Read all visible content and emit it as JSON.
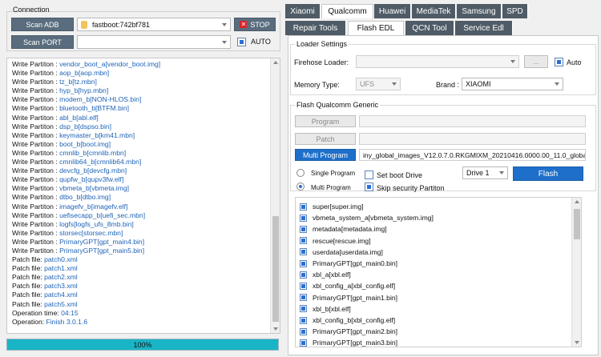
{
  "connection": {
    "title": "Connection",
    "scan_adb_label": "Scan ADB",
    "device_value": "fastboot:742bf781",
    "stop_label": "STOP",
    "scan_port_label": "Scan PORT",
    "port_value": "",
    "auto_label": "AUTO",
    "auto_checked": true
  },
  "log": [
    {
      "label": "Write Partiton : ",
      "value": "vendor_boot_a[vendor_boot.img]"
    },
    {
      "label": "Write Partiton : ",
      "value": "aop_b[aop.mbn]"
    },
    {
      "label": "Write Partiton : ",
      "value": "tz_b[tz.mbn]"
    },
    {
      "label": "Write Partiton : ",
      "value": "hyp_b[hyp.mbn]"
    },
    {
      "label": "Write Partiton : ",
      "value": "modem_b[NON-HLOS.bin]"
    },
    {
      "label": "Write Partiton : ",
      "value": "bluetooth_b[BTFM.bin]"
    },
    {
      "label": "Write Partiton : ",
      "value": "abl_b[abl.elf]"
    },
    {
      "label": "Write Partiton : ",
      "value": "dsp_b[dspso.bin]"
    },
    {
      "label": "Write Partiton : ",
      "value": "keymaster_b[km41.mbn]"
    },
    {
      "label": "Write Partiton : ",
      "value": "boot_b[boot.img]"
    },
    {
      "label": "Write Partiton : ",
      "value": "cmnlib_b[cmnlib.mbn]"
    },
    {
      "label": "Write Partiton : ",
      "value": "cmnlib64_b[cmnlib64.mbn]"
    },
    {
      "label": "Write Partiton : ",
      "value": "devcfg_b[devcfg.mbn]"
    },
    {
      "label": "Write Partiton : ",
      "value": "qupfw_b[qupv3fw.elf]"
    },
    {
      "label": "Write Partiton : ",
      "value": "vbmeta_b[vbmeta.img]"
    },
    {
      "label": "Write Partiton : ",
      "value": "dtbo_b[dtbo.img]"
    },
    {
      "label": "Write Partiton : ",
      "value": "imagefv_b[imagefv.elf]"
    },
    {
      "label": "Write Partiton : ",
      "value": "uefisecapp_b[uefi_sec.mbn]"
    },
    {
      "label": "Write Partiton : ",
      "value": "logfs[logfs_ufs_8mb.bin]"
    },
    {
      "label": "Write Partiton : ",
      "value": "storsec[storsec.mbn]"
    },
    {
      "label": "Write Partiton : ",
      "value": "PrimaryGPT[gpt_main4.bin]"
    },
    {
      "label": "Write Partiton : ",
      "value": "PrimaryGPT[gpt_main5.bin]"
    },
    {
      "label": "Patch file: ",
      "value": "patch0.xml"
    },
    {
      "label": "Patch file: ",
      "value": "patch1.xml"
    },
    {
      "label": "Patch file: ",
      "value": "patch2.xml"
    },
    {
      "label": "Patch file: ",
      "value": "patch3.xml"
    },
    {
      "label": "Patch file: ",
      "value": "patch4.xml"
    },
    {
      "label": "Patch file: ",
      "value": "patch5.xml"
    },
    {
      "label": "Operation time: ",
      "value": "04:15"
    },
    {
      "label": "Operation: ",
      "value": "Finish 3.0.1.6"
    }
  ],
  "progress": {
    "value": 1.0,
    "label": "100%"
  },
  "brand_tabs": [
    {
      "label": "Xiaomi",
      "active": false
    },
    {
      "label": "Qualcomm",
      "active": true
    },
    {
      "label": "Huawei",
      "active": false
    },
    {
      "label": "MediaTek",
      "active": false
    },
    {
      "label": "Samsung",
      "active": false
    },
    {
      "label": "SPD",
      "active": false
    }
  ],
  "sub_tabs": [
    {
      "label": "Repair Tools",
      "active": false
    },
    {
      "label": "Flash EDL",
      "active": true
    },
    {
      "label": "QCN Tool",
      "active": false
    },
    {
      "label": "Service Edl",
      "active": false
    }
  ],
  "loader": {
    "title": "Loader Settings",
    "firehose_label": "Firehose Loader:",
    "firehose_value": "",
    "browse_label": "...",
    "auto_label": "Auto",
    "auto_checked": true,
    "memory_label": "Memory Type:",
    "memory_value": "UFS",
    "brand_label": "Brand :",
    "brand_value": "XIAOMI"
  },
  "flash": {
    "title": "Flash Qualcomm Generic",
    "program_label": "Program",
    "patch_label": "Patch",
    "multi_program_label": "Multi Program",
    "multi_program_path": "iny_global_images_V12.0.7.0.RKGMIXM_20210416.0000.00_11.0_global/images",
    "single_program_label": "Single Program",
    "multi_program_radio_label": "Multi Program",
    "set_boot_label": "Set boot Drive",
    "skip_security_label": "Skip security Partiton",
    "drive_value": "Drive 1",
    "flash_label": "Flash"
  },
  "partitions": [
    "super[super.img]",
    "vbmeta_system_a[vbmeta_system.img]",
    "metadata[metadata.img]",
    "rescue[rescue.img]",
    "userdata[userdata.img]",
    "PrimaryGPT[gpt_main0.bin]",
    "xbl_a[xbl.elf]",
    "xbl_config_a[xbl_config.elf]",
    "PrimaryGPT[gpt_main1.bin]",
    "xbl_b[xbl.elf]",
    "xbl_config_b[xbl_config.elf]",
    "PrimaryGPT[gpt_main2.bin]",
    "PrimaryGPT[gpt_main3.bin]"
  ]
}
